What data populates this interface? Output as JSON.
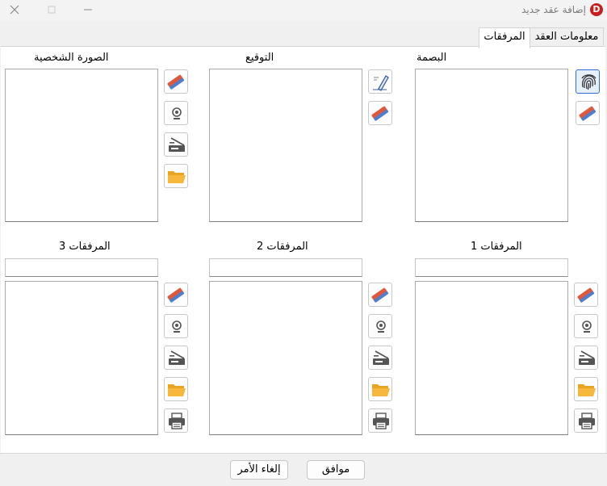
{
  "window": {
    "title": "إضافة عقد جديد",
    "logo_letter": "D"
  },
  "tabs": [
    {
      "label": "معلومات العقد"
    },
    {
      "label": "المرفقات"
    }
  ],
  "sections": {
    "fingerprint": {
      "label": "البصمة"
    },
    "signature": {
      "label": "التوقيع"
    },
    "photo": {
      "label": "الصورة الشخصية"
    },
    "attachment1": {
      "label": "المرفقات 1",
      "name_value": ""
    },
    "attachment2": {
      "label": "المرفقات 2",
      "name_value": ""
    },
    "attachment3": {
      "label": "المرفقات 3",
      "name_value": ""
    }
  },
  "buttons": {
    "ok": "موافق",
    "cancel": "إلغاء الأمر"
  },
  "icons": [
    "fingerprint-icon",
    "eraser-icon",
    "pen-icon",
    "webcam-icon",
    "scanner-icon",
    "folder-icon",
    "printer-icon"
  ],
  "colors": {
    "eraser_red": "#e0583b",
    "folder_yellow": "#f6b73c",
    "active_blue": "#2f6ed3",
    "logo_red": "#c81e1e"
  }
}
